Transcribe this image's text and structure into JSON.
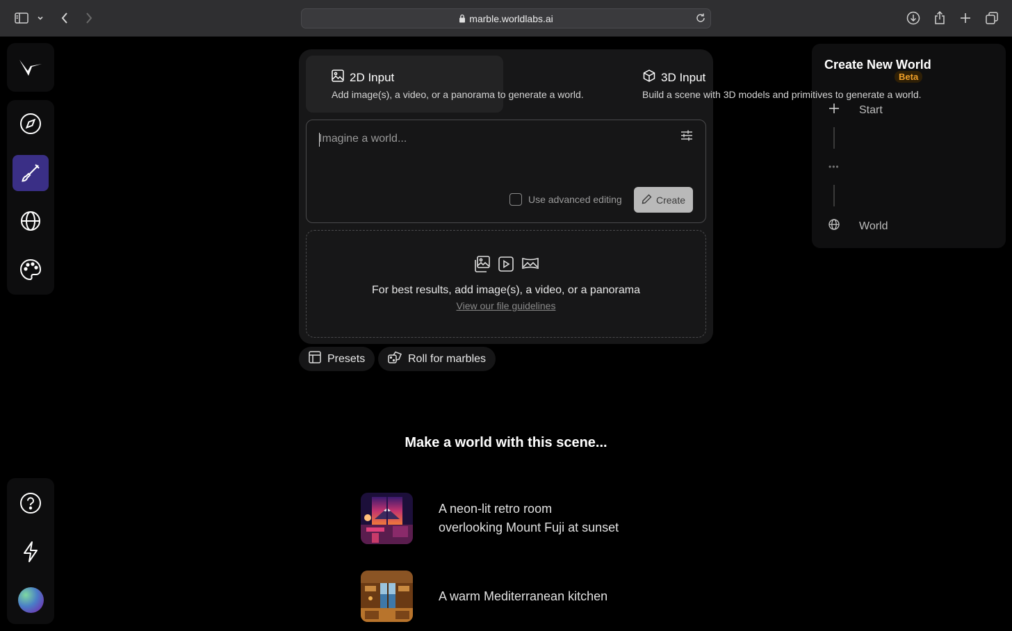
{
  "browser": {
    "url": "marble.worldlabs.ai"
  },
  "tabs": {
    "input2d": {
      "title": "2D Input",
      "description": "Add image(s), a video, or a panorama to generate a world."
    },
    "input3d": {
      "title": "3D Input",
      "description": "Build a scene with 3D models and primitives to generate a world."
    }
  },
  "prompt": {
    "placeholder": "Imagine a world...",
    "advanced_label": "Use advanced editing",
    "advanced_checked": false,
    "create_label": "Create"
  },
  "dropzone": {
    "message": "For best results, add image(s), a video, or a panorama",
    "link": "View our file guidelines"
  },
  "pills": {
    "presets": "Presets",
    "roll": "Roll for marbles"
  },
  "scenes": {
    "heading": "Make a world with this scene...",
    "items": [
      {
        "line1": "A neon-lit retro room",
        "line2": "overlooking Mount Fuji at sunset"
      },
      {
        "line1": "A warm Mediterranean kitchen"
      }
    ]
  },
  "panel": {
    "title": "Create New World",
    "badge": "Beta",
    "steps": {
      "start": "Start",
      "world": "World"
    }
  },
  "colors": {
    "accent": "#3a2f86",
    "badge": "#f0a028",
    "background": "#000000",
    "card": "#171718"
  },
  "icons": {
    "sidebar": [
      "logo-icon",
      "compass-icon",
      "brush-icon",
      "globe-icon",
      "palette-icon",
      "help-icon",
      "lightning-icon",
      "avatar"
    ]
  }
}
